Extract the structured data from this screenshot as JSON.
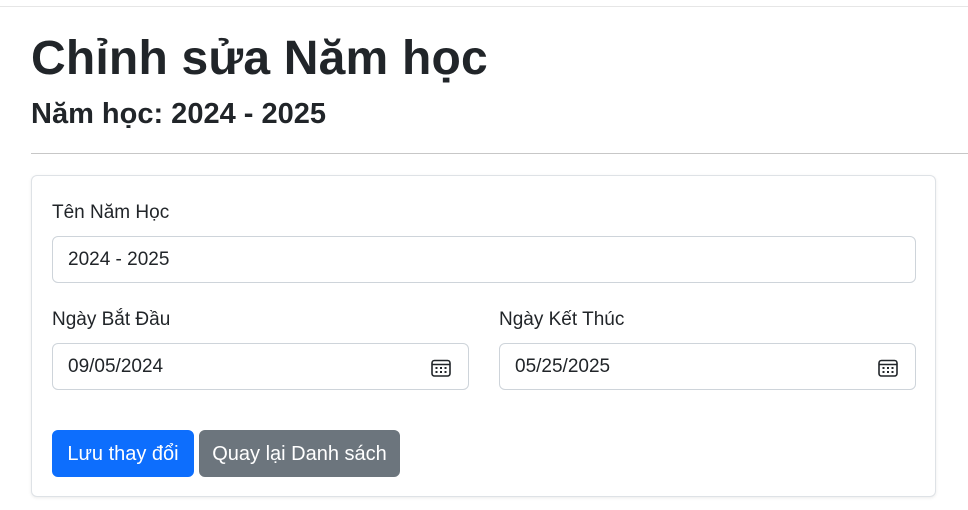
{
  "header": {
    "title": "Chỉnh sửa Năm học",
    "subtitle": "Năm học: 2024 - 2025"
  },
  "form": {
    "name_label": "Tên Năm Học",
    "name_value": "2024 - 2025",
    "start_label": "Ngày Bắt Đầu",
    "start_value": "09/05/2024",
    "end_label": "Ngày Kết Thúc",
    "end_value": "05/25/2025"
  },
  "actions": {
    "save_label": "Lưu thay đổi",
    "back_label": "Quay lại Danh sách"
  },
  "icons": {
    "date_picker": "calendar-icon"
  },
  "colors": {
    "primary": "#0d6efd",
    "secondary": "#6c757d"
  }
}
